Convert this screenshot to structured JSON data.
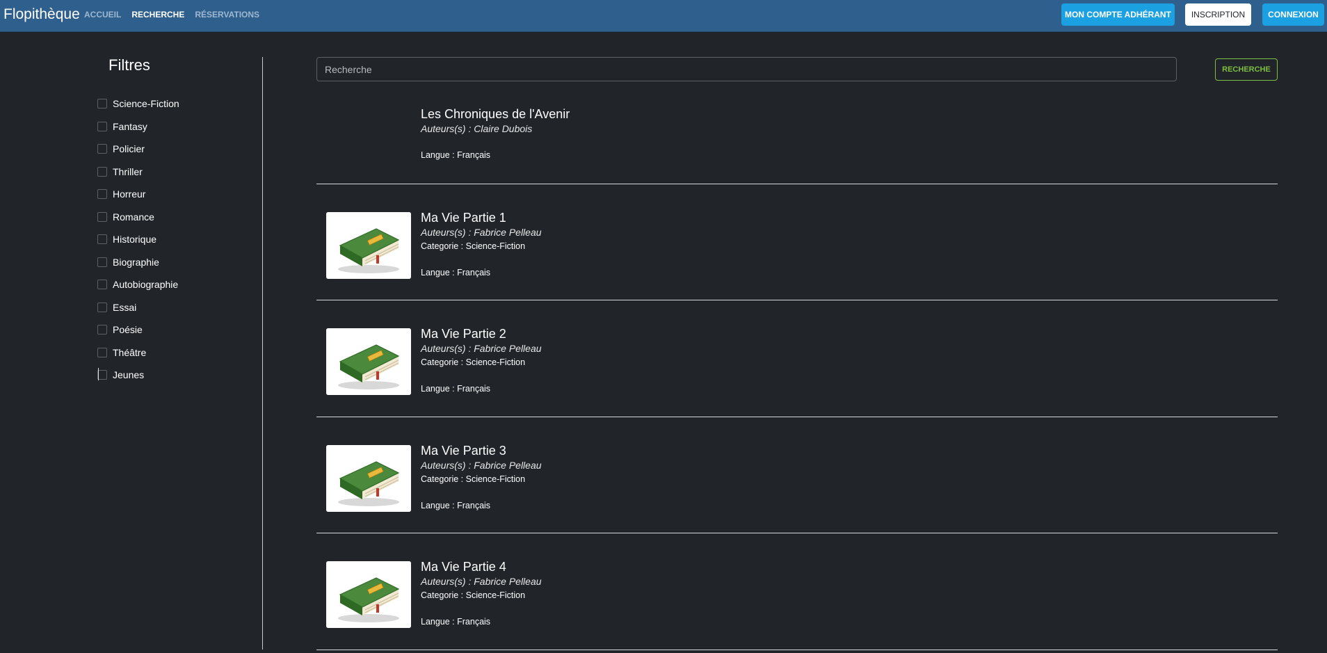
{
  "navbar": {
    "brand": "Flopithèque",
    "links": [
      {
        "label": "ACCUEIL",
        "active": false
      },
      {
        "label": "RECHERCHE",
        "active": true
      },
      {
        "label": "RÉSERVATIONS",
        "active": false
      }
    ],
    "account_button": "MON COMPTE ADHÉRANT",
    "register_button": "INSCRIPTION",
    "login_button": "CONNEXION"
  },
  "sidebar": {
    "title": "Filtres",
    "filters": [
      {
        "label": "Science-Fiction",
        "checked": false
      },
      {
        "label": "Fantasy",
        "checked": false
      },
      {
        "label": "Policier",
        "checked": false
      },
      {
        "label": "Thriller",
        "checked": false
      },
      {
        "label": "Horreur",
        "checked": false
      },
      {
        "label": "Romance",
        "checked": false
      },
      {
        "label": "Historique",
        "checked": false
      },
      {
        "label": "Biographie",
        "checked": false
      },
      {
        "label": "Autobiographie",
        "checked": false
      },
      {
        "label": "Essai",
        "checked": false
      },
      {
        "label": "Poésie",
        "checked": false
      },
      {
        "label": "Théâtre",
        "checked": false
      },
      {
        "label": "Jeunes",
        "checked": false
      }
    ]
  },
  "search": {
    "placeholder": "Recherche",
    "value": "",
    "button_label": "RECHERCHE"
  },
  "results": [
    {
      "title": "Les Chroniques de l'Avenir",
      "authors": "Auteurs(s) : Claire Dubois",
      "category": "",
      "language": "Langue : Français",
      "has_cover": false
    },
    {
      "title": "Ma Vie Partie 1",
      "authors": "Auteurs(s) : Fabrice Pelleau",
      "category": "Categorie : Science-Fiction",
      "language": "Langue : Français",
      "has_cover": true
    },
    {
      "title": "Ma Vie Partie 2",
      "authors": "Auteurs(s) : Fabrice Pelleau",
      "category": "Categorie : Science-Fiction",
      "language": "Langue : Français",
      "has_cover": true
    },
    {
      "title": "Ma Vie Partie 3",
      "authors": "Auteurs(s) : Fabrice Pelleau",
      "category": "Categorie : Science-Fiction",
      "language": "Langue : Français",
      "has_cover": true
    },
    {
      "title": "Ma Vie Partie 4",
      "authors": "Auteurs(s) : Fabrice Pelleau",
      "category": "Categorie : Science-Fiction",
      "language": "Langue : Français",
      "has_cover": true
    }
  ],
  "colors": {
    "navbar_bg": "#2f5f8c",
    "page_bg": "#212529",
    "primary_button": "#1ba1e2",
    "search_button": "#7dbf40"
  },
  "icons": {
    "book_cover": "green-book-icon"
  }
}
